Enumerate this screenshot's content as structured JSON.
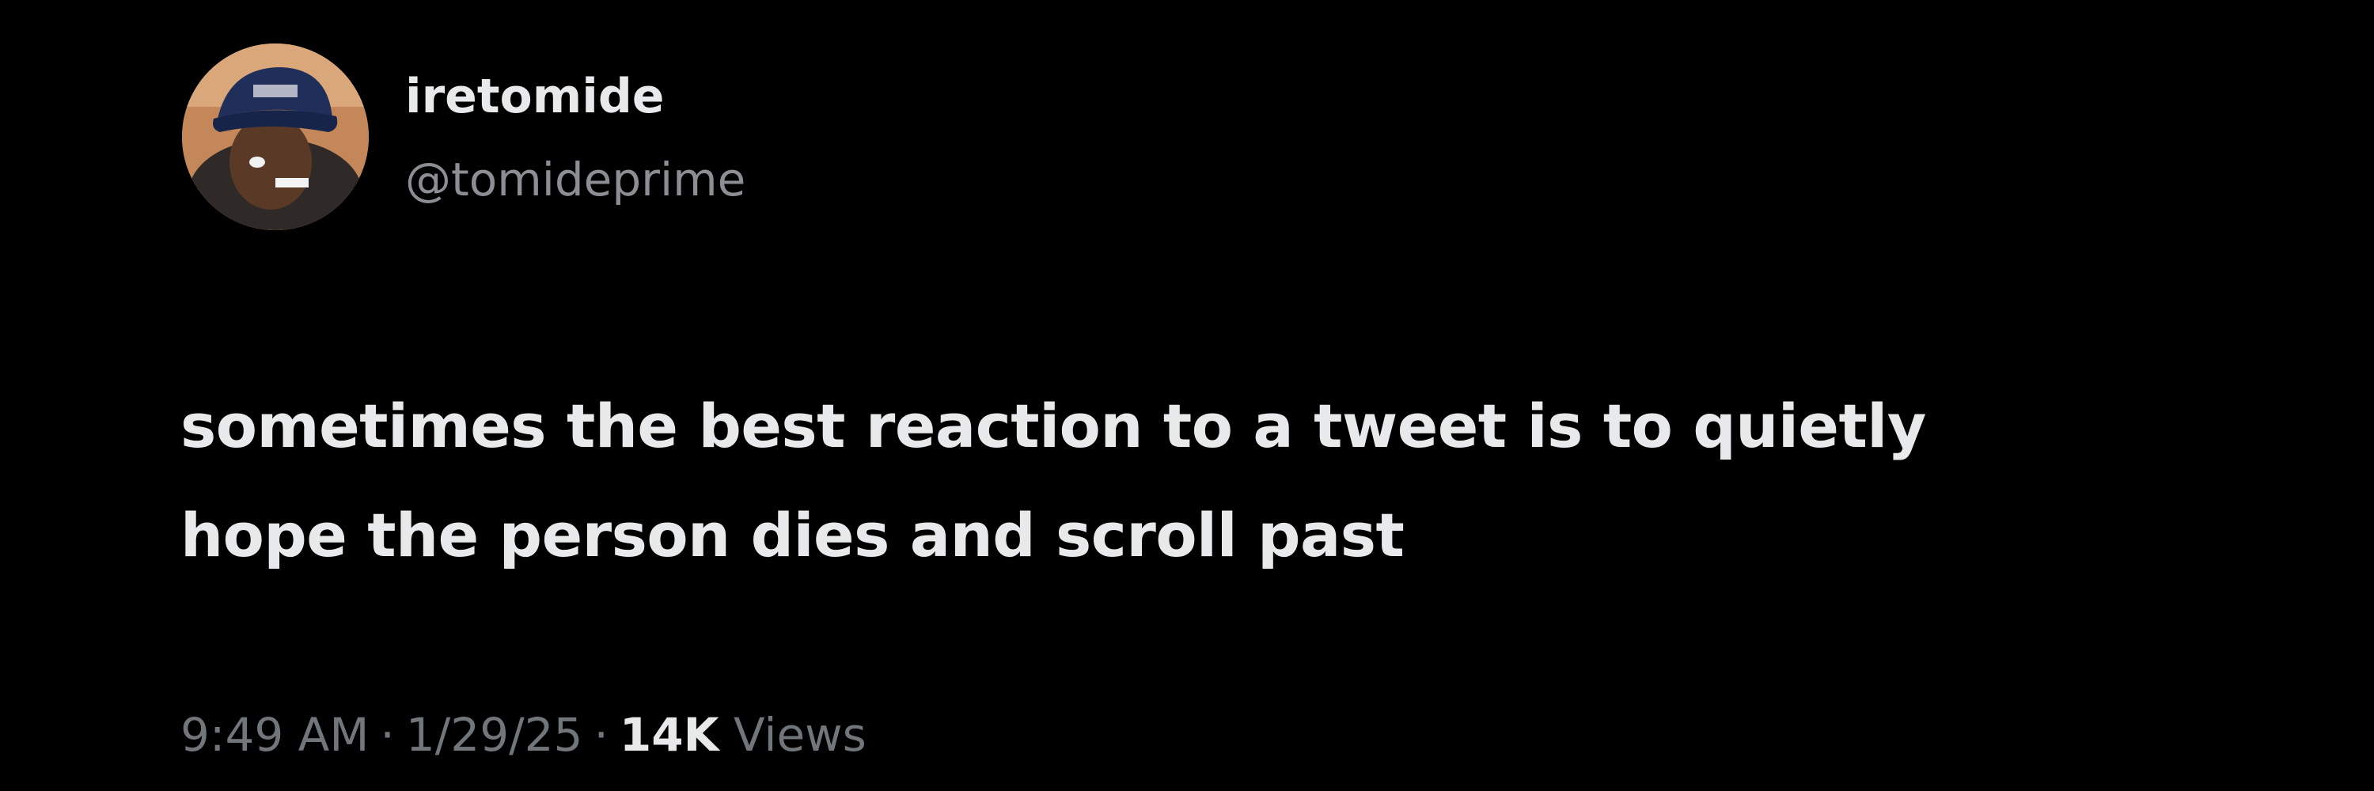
{
  "author": {
    "display_name": "iretomide",
    "handle": "@tomideprime"
  },
  "tweet": {
    "lines": [
      "sometimes the best reaction to a tweet is to quietly",
      "hope the person dies and scroll past"
    ]
  },
  "meta": {
    "time": "9:49 AM",
    "separator": "·",
    "date": "1/29/25",
    "views_count": "14K",
    "views_label": "Views"
  },
  "colors": {
    "background": "#000000",
    "primary_text": "#e7e9ea",
    "secondary_text": "#71767b"
  }
}
